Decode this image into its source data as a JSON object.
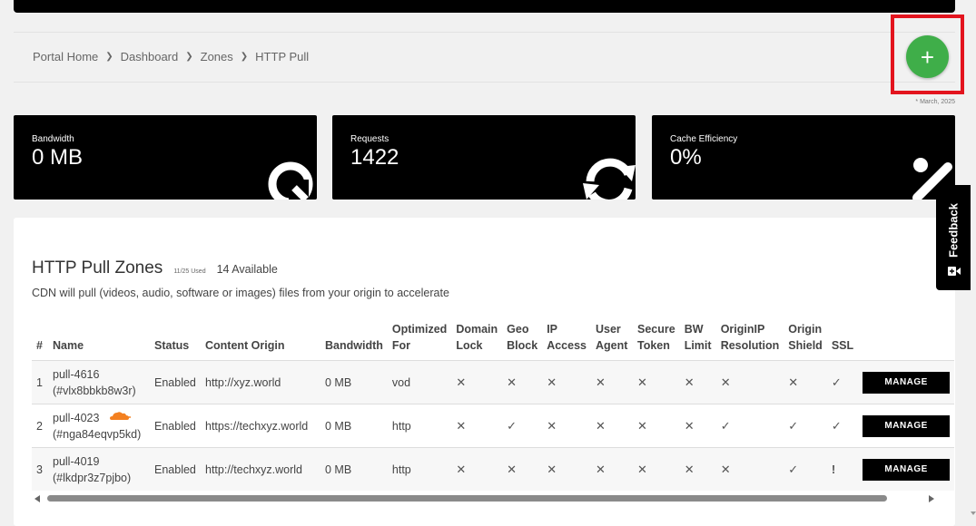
{
  "breadcrumb": [
    "Portal Home",
    "Dashboard",
    "Zones",
    "HTTP Pull"
  ],
  "add_button": {
    "symbol": "+",
    "color": "#3fae49"
  },
  "highlight_color": "#e3141e",
  "date_note": "* March, 2025",
  "stats": [
    {
      "label": "Bandwidth",
      "value": "0 MB",
      "icon": "pie-chart-icon"
    },
    {
      "label": "Requests",
      "value": "1422",
      "icon": "refresh-icon"
    },
    {
      "label": "Cache Efficiency",
      "value": "0%",
      "icon": "percent-icon"
    }
  ],
  "zones": {
    "title": "HTTP Pull Zones",
    "used": "11/25 Used",
    "available": "14 Available",
    "description": "CDN will pull (videos, audio, software or images) files from your origin to accelerate",
    "columns": {
      "num": "#",
      "name": "Name",
      "status": "Status",
      "content_origin": "Content Origin",
      "bandwidth": "Bandwidth",
      "optimized_1": "Optimized",
      "optimized_2": "For",
      "domain_1": "Domain",
      "domain_2": "Lock",
      "geo_1": "Geo",
      "geo_2": "Block",
      "ip_1": "IP",
      "ip_2": "Access",
      "ua_1": "User",
      "ua_2": "Agent",
      "st_1": "Secure",
      "st_2": "Token",
      "bw_1": "BW",
      "bw_2": "Limit",
      "oip_1": "OriginIP",
      "oip_2": "Resolution",
      "os_1": "Origin",
      "os_2": "Shield",
      "ssl": "SSL"
    },
    "rows": [
      {
        "num": "1",
        "name": "pull-4616",
        "id": "(#vlx8bbkb8w3r)",
        "status": "Enabled",
        "origin": "http://xyz.world",
        "bandwidth": "0 MB",
        "optimized": "vod",
        "domain_lock": "✕",
        "geo_block": "✕",
        "ip_access": "✕",
        "user_agent": "✕",
        "secure_token": "✕",
        "bw_limit": "✕",
        "originip": "✕",
        "origin_shield": "✕",
        "ssl": "✓",
        "manage": "MANAGE"
      },
      {
        "num": "2",
        "name": "pull-4023",
        "id": "(#nga84eqvp5kd)",
        "status": "Enabled",
        "origin": "https://techxyz.world",
        "bandwidth": "0 MB",
        "optimized": "http",
        "domain_lock": "✕",
        "geo_block": "✓",
        "ip_access": "✕",
        "user_agent": "✕",
        "secure_token": "✕",
        "bw_limit": "✕",
        "originip": "✓",
        "origin_shield": "✓",
        "ssl": "✓",
        "manage": "MANAGE"
      },
      {
        "num": "3",
        "name": "pull-4019",
        "id": "(#lkdpr3z7pjbo)",
        "status": "Enabled",
        "origin": "http://techxyz.world",
        "bandwidth": "0 MB",
        "optimized": "http",
        "domain_lock": "✕",
        "geo_block": "✕",
        "ip_access": "✕",
        "user_agent": "✕",
        "secure_token": "✕",
        "bw_limit": "✕",
        "originip": "✕",
        "origin_shield": "✓",
        "ssl": "!",
        "manage": "MANAGE"
      }
    ]
  },
  "feedback": {
    "label": "Feedback",
    "icon": "video-icon"
  }
}
